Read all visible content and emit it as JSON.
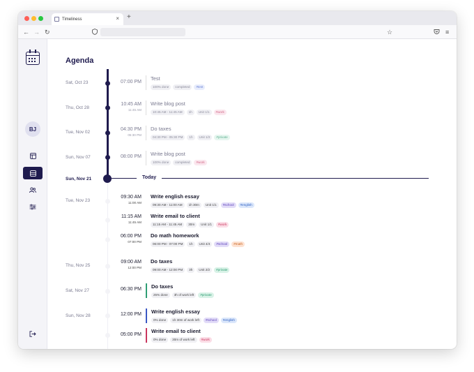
{
  "browser": {
    "tab_title": "Timeliness",
    "tab_close": "×",
    "new_tab": "+"
  },
  "sidebar": {
    "avatar_initials": "BJ"
  },
  "agenda": {
    "title": "Agenda",
    "today_label": "Today",
    "dates": [
      {
        "label": "Sat, Oct 23"
      },
      {
        "label": "Thu, Oct 28"
      },
      {
        "label": "Tue, Nov 02"
      },
      {
        "label": "Sun, Nov 07"
      },
      {
        "label": "Sun, Nov 21"
      },
      {
        "label": "Tue, Nov 23"
      },
      {
        "label": "Thu, Nov 25"
      },
      {
        "label": "Sat, Nov 27"
      },
      {
        "label": "Sun, Nov 28"
      }
    ],
    "events": [
      {
        "time": "07:00 PM",
        "sub": "",
        "title": "Test",
        "chips": [
          "100% done",
          "completed",
          "#test"
        ]
      },
      {
        "time": "10:45 AM",
        "sub": "11:45 AM",
        "title": "Write blog post",
        "chips": [
          "10:45 AM - 11:45 AM",
          "1h",
          "Unit 1/1",
          "#work"
        ]
      },
      {
        "time": "04:30 PM",
        "sub": "05:30 PM",
        "title": "Do taxes",
        "chips": [
          "04:30 PM - 05:30 PM",
          "1h",
          "Unit 1/2",
          "#private"
        ]
      },
      {
        "time": "08:00 PM",
        "sub": "",
        "title": "Write blog post",
        "chips": [
          "100% done",
          "completed",
          "#work"
        ]
      },
      {
        "time": "09:30 AM",
        "sub": "11:00 AM",
        "title": "Write english essay",
        "chips": [
          "09:30 AM - 11:00 AM",
          "1h 30m",
          "Unit 1/1",
          "#school",
          "#english"
        ]
      },
      {
        "time": "11:15 AM",
        "sub": "11:45 AM",
        "title": "Write email to client",
        "chips": [
          "11:15 AM - 11:45 AM",
          "30m",
          "Unit 1/1",
          "#work"
        ]
      },
      {
        "time": "06:00 PM",
        "sub": "07:00 PM",
        "title": "Do math homework",
        "chips": [
          "06:00 PM - 07:00 PM",
          "1h",
          "Unit 4/4",
          "#school",
          "#math"
        ]
      },
      {
        "time": "09:00 AM",
        "sub": "12:00 PM",
        "title": "Do taxes",
        "chips": [
          "09:00 AM - 12:00 PM",
          "3h",
          "Unit 2/2",
          "#private"
        ]
      },
      {
        "time": "06:30 PM",
        "sub": "",
        "title": "Do taxes",
        "chips": [
          "25% done",
          "3h of work left",
          "#private"
        ]
      },
      {
        "time": "12:00 PM",
        "sub": "",
        "title": "Write english essay",
        "chips": [
          "0% done",
          "1h 30m of work left",
          "#school",
          "#english"
        ]
      },
      {
        "time": "05:00 PM",
        "sub": "",
        "title": "Write email to client",
        "chips": [
          "0% done",
          "30m of work left",
          "#work"
        ]
      }
    ]
  }
}
